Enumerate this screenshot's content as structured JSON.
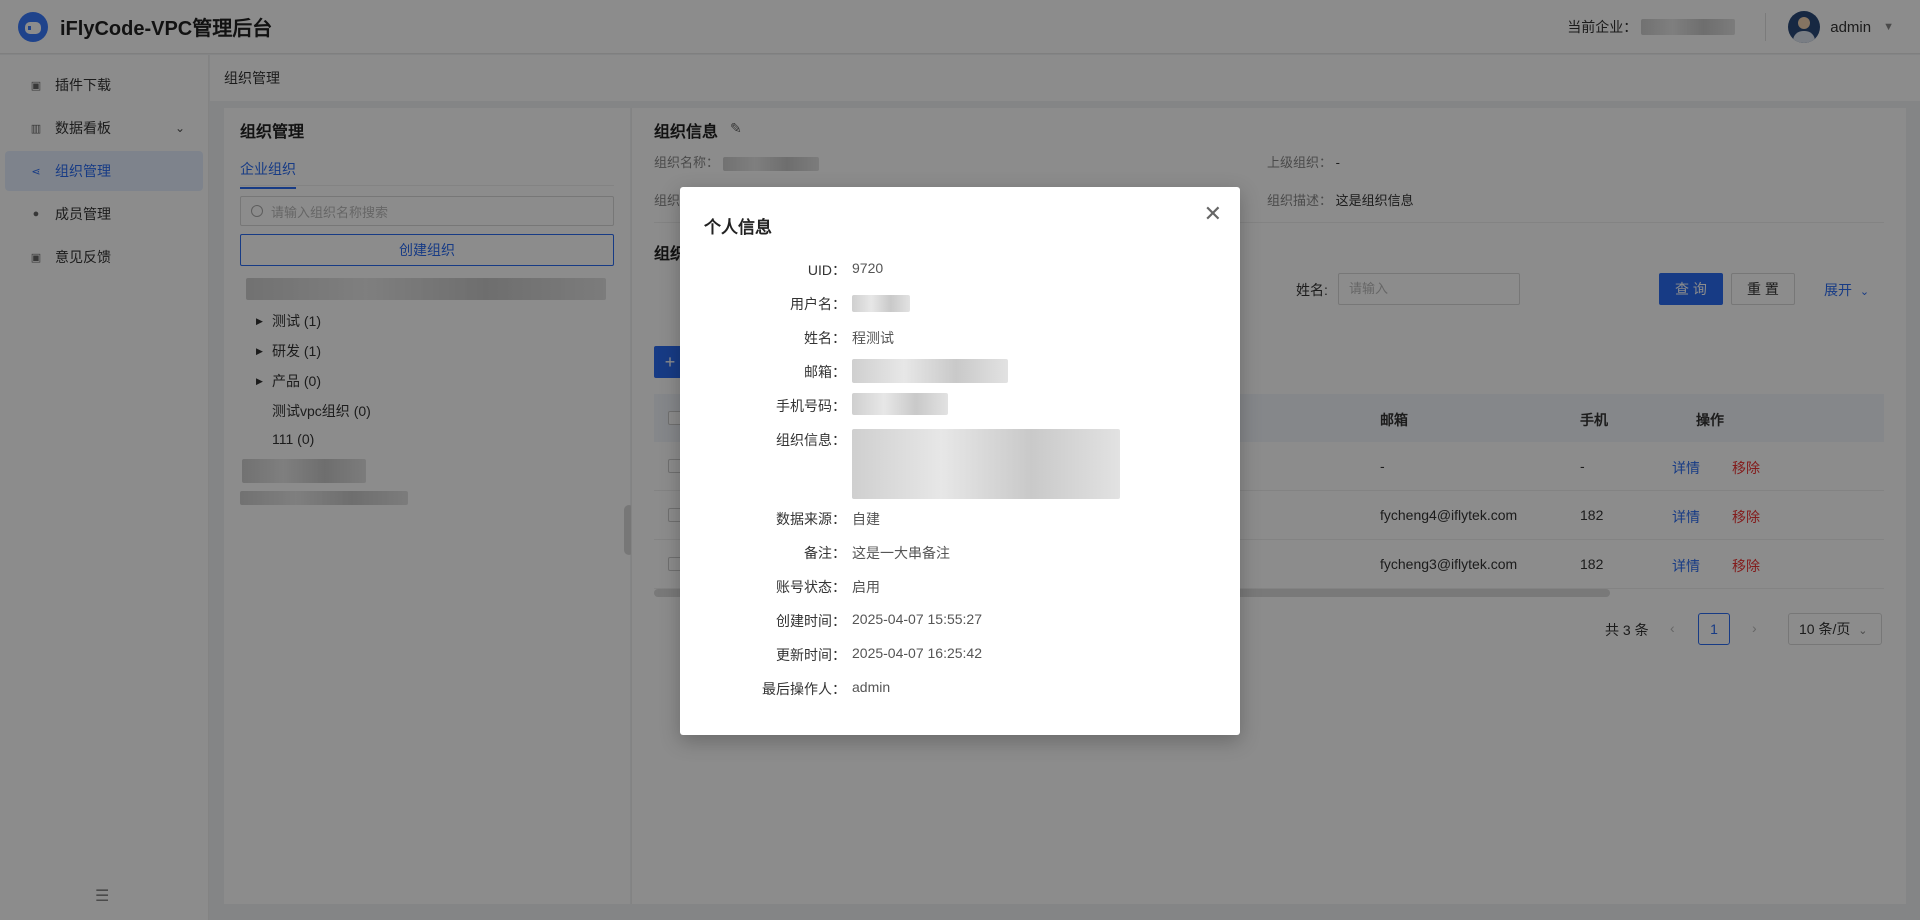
{
  "app": {
    "title": "iFlyCode-VPC管理后台"
  },
  "header": {
    "company_label": "当前企业：",
    "user_name": "admin"
  },
  "sidebar": {
    "items": [
      {
        "label": "插件下载",
        "icon": "chart-line-icon"
      },
      {
        "label": "数据看板",
        "icon": "bar-chart-icon"
      },
      {
        "label": "组织管理",
        "icon": "share-nodes-icon",
        "active": true
      },
      {
        "label": "成员管理",
        "icon": "user-icon"
      },
      {
        "label": "意见反馈",
        "icon": "feedback-icon"
      }
    ]
  },
  "breadcrumb": "组织管理",
  "org_panel": {
    "title": "组织管理",
    "tab": "企业组织",
    "search_placeholder": "请输入组织名称搜索",
    "create_label": "创建组织",
    "nodes": [
      {
        "name": "测试",
        "count": "(1)"
      },
      {
        "name": "研发",
        "count": "(1)"
      },
      {
        "name": "产品",
        "count": "(0)"
      },
      {
        "name": "测试vpc组织",
        "count": "(0)"
      },
      {
        "name": "111",
        "count": "(0)"
      }
    ]
  },
  "org_info": {
    "title": "组织信息",
    "name_label": "组织名称：",
    "parent_label": "上级组织：",
    "parent_value": "-",
    "org_prefix": "组织",
    "desc_label": "组织描述：",
    "desc_value": "这是组织信息",
    "members_title_prefix": "组织"
  },
  "filter": {
    "name_label": "姓名:",
    "name_placeholder": "请输入",
    "query_label": "查 询",
    "reset_label": "重 置",
    "expand_label": "展开"
  },
  "table": {
    "headers": {
      "email": "邮箱",
      "phone": "手机",
      "ops": "操作"
    },
    "rows": [
      {
        "email": "-",
        "phone": "-",
        "detail": "详情",
        "remove": "移除"
      },
      {
        "email": "fycheng4@iflytek.com",
        "phone": "182",
        "detail": "详情",
        "remove": "移除"
      },
      {
        "email": "fycheng3@iflytek.com",
        "phone": "182",
        "detail": "详情",
        "remove": "移除"
      }
    ]
  },
  "pagination": {
    "total": "共 3 条",
    "page": "1",
    "page_size": "10 条/页"
  },
  "modal": {
    "title": "个人信息",
    "fields": [
      {
        "label": "UID：",
        "value": "9720"
      },
      {
        "label": "用户名：",
        "value": ""
      },
      {
        "label": "姓名：",
        "value": "程测试"
      },
      {
        "label": "邮箱：",
        "value": ""
      },
      {
        "label": "手机号码：",
        "value": ""
      },
      {
        "label": "组织信息：",
        "value": ""
      },
      {
        "label": "数据来源：",
        "value": "自建"
      },
      {
        "label": "备注：",
        "value": "这是一大串备注"
      },
      {
        "label": "账号状态：",
        "value": "启用"
      },
      {
        "label": "创建时间：",
        "value": "2025-04-07 15:55:27"
      },
      {
        "label": "更新时间：",
        "value": "2025-04-07 16:25:42"
      },
      {
        "label": "最后操作人：",
        "value": "admin"
      }
    ]
  }
}
